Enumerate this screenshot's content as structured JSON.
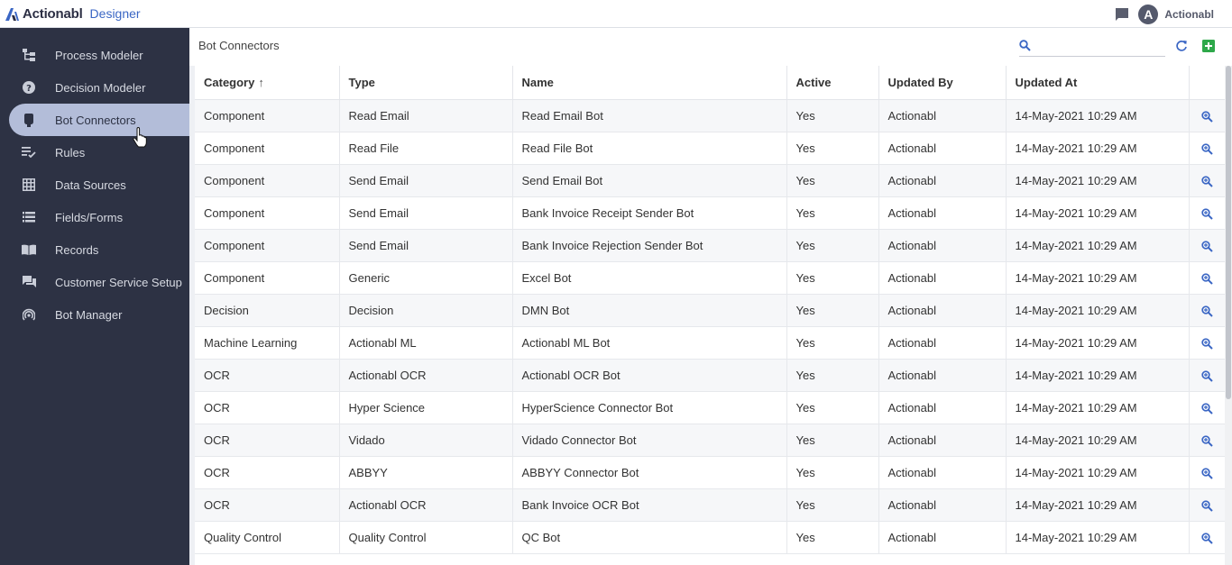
{
  "app": {
    "brand": "Actionabl",
    "module": "Designer"
  },
  "header": {
    "user_initial": "A",
    "user_name": "Actionabl"
  },
  "sidebar": {
    "items": [
      {
        "label": "Process Modeler",
        "icon": "process-icon"
      },
      {
        "label": "Decision Modeler",
        "icon": "help-circle-icon"
      },
      {
        "label": "Bot Connectors",
        "icon": "plug-icon",
        "active": true
      },
      {
        "label": "Rules",
        "icon": "rules-icon"
      },
      {
        "label": "Data Sources",
        "icon": "grid-icon"
      },
      {
        "label": "Fields/Forms",
        "icon": "list-icon"
      },
      {
        "label": "Records",
        "icon": "book-icon"
      },
      {
        "label": "Customer Service Setup",
        "icon": "chat-icon"
      },
      {
        "label": "Bot Manager",
        "icon": "broadcast-icon"
      }
    ]
  },
  "main": {
    "title": "Bot Connectors",
    "search": {
      "value": "",
      "placeholder": ""
    },
    "columns": [
      "Category",
      "Type",
      "Name",
      "Active",
      "Updated By",
      "Updated At"
    ],
    "sort_indicator": "↑",
    "rows": [
      [
        "Component",
        "Read Email",
        "Read Email Bot",
        "Yes",
        "Actionabl",
        "14-May-2021 10:29 AM"
      ],
      [
        "Component",
        "Read File",
        "Read File Bot",
        "Yes",
        "Actionabl",
        "14-May-2021 10:29 AM"
      ],
      [
        "Component",
        "Send Email",
        "Send Email Bot",
        "Yes",
        "Actionabl",
        "14-May-2021 10:29 AM"
      ],
      [
        "Component",
        "Send Email",
        "Bank Invoice Receipt Sender Bot",
        "Yes",
        "Actionabl",
        "14-May-2021 10:29 AM"
      ],
      [
        "Component",
        "Send Email",
        "Bank Invoice Rejection Sender Bot",
        "Yes",
        "Actionabl",
        "14-May-2021 10:29 AM"
      ],
      [
        "Component",
        "Generic",
        "Excel Bot",
        "Yes",
        "Actionabl",
        "14-May-2021 10:29 AM"
      ],
      [
        "Decision",
        "Decision",
        "DMN Bot",
        "Yes",
        "Actionabl",
        "14-May-2021 10:29 AM"
      ],
      [
        "Machine Learning",
        "Actionabl ML",
        "Actionabl ML Bot",
        "Yes",
        "Actionabl",
        "14-May-2021 10:29 AM"
      ],
      [
        "OCR",
        "Actionabl OCR",
        "Actionabl OCR Bot",
        "Yes",
        "Actionabl",
        "14-May-2021 10:29 AM"
      ],
      [
        "OCR",
        "Hyper Science",
        "HyperScience Connector Bot",
        "Yes",
        "Actionabl",
        "14-May-2021 10:29 AM"
      ],
      [
        "OCR",
        "Vidado",
        "Vidado Connector Bot",
        "Yes",
        "Actionabl",
        "14-May-2021 10:29 AM"
      ],
      [
        "OCR",
        "ABBYY",
        "ABBYY Connector Bot",
        "Yes",
        "Actionabl",
        "14-May-2021 10:29 AM"
      ],
      [
        "OCR",
        "Actionabl OCR",
        "Bank Invoice OCR Bot",
        "Yes",
        "Actionabl",
        "14-May-2021 10:29 AM"
      ],
      [
        "Quality Control",
        "Quality Control",
        "QC Bot",
        "Yes",
        "Actionabl",
        "14-May-2021 10:29 AM"
      ]
    ]
  },
  "colors": {
    "sidebar_bg": "#2d3244",
    "active_item_bg": "#b3bdd9",
    "accent_blue": "#3a66c4",
    "add_green": "#2ea84a"
  }
}
